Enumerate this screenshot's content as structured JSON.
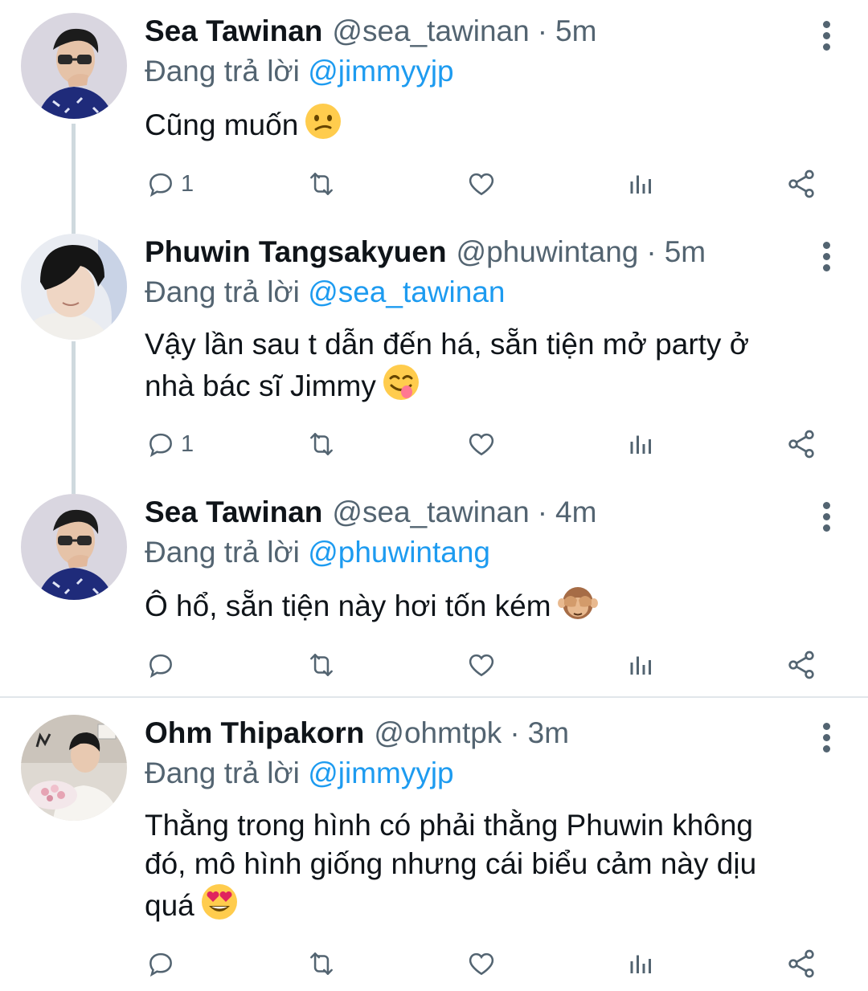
{
  "replying_prefix": "Đang trả lời",
  "tweets": [
    {
      "name": "Sea Tawinan",
      "handle": "@sea_tawinan",
      "separator": "·",
      "time": "5m",
      "replying_to": "@jimmyyjp",
      "text": "Cũng muốn",
      "emoji": "confused-face",
      "reply_count": "1"
    },
    {
      "name": "Phuwin Tangsakyuen",
      "handle": "@phuwintang",
      "separator": "·",
      "time": "5m",
      "replying_to": "@sea_tawinan",
      "text_lines": [
        "Vậy lần sau t dẫn đến há, sẵn tiện mở party ở",
        "nhà bác sĩ Jimmy"
      ],
      "emoji": "face-savoring-food",
      "reply_count": "1"
    },
    {
      "name": "Sea Tawinan",
      "handle": "@sea_tawinan",
      "separator": "·",
      "time": "4m",
      "replying_to": "@phuwintang",
      "text": "Ô hổ, sẵn tiện này hơi tốn kém",
      "emoji": "see-no-evil-monkey",
      "reply_count": ""
    },
    {
      "name": "Ohm Thipakorn",
      "handle": "@ohmtpk",
      "separator": "·",
      "time": "3m",
      "replying_to": "@jimmyyjp",
      "text_lines": [
        "Thằng trong hình có phải thằng Phuwin không",
        "đó, mô hình giống nhưng cái biểu cảm này dịu",
        "quá"
      ],
      "emoji": "heart-eyes-face",
      "reply_count": ""
    }
  ],
  "colors": {
    "text": "#0f1419",
    "secondary": "#536471",
    "link": "#1d9bf0",
    "thread_line": "#cfd9de",
    "divider": "#e1e6ea"
  }
}
